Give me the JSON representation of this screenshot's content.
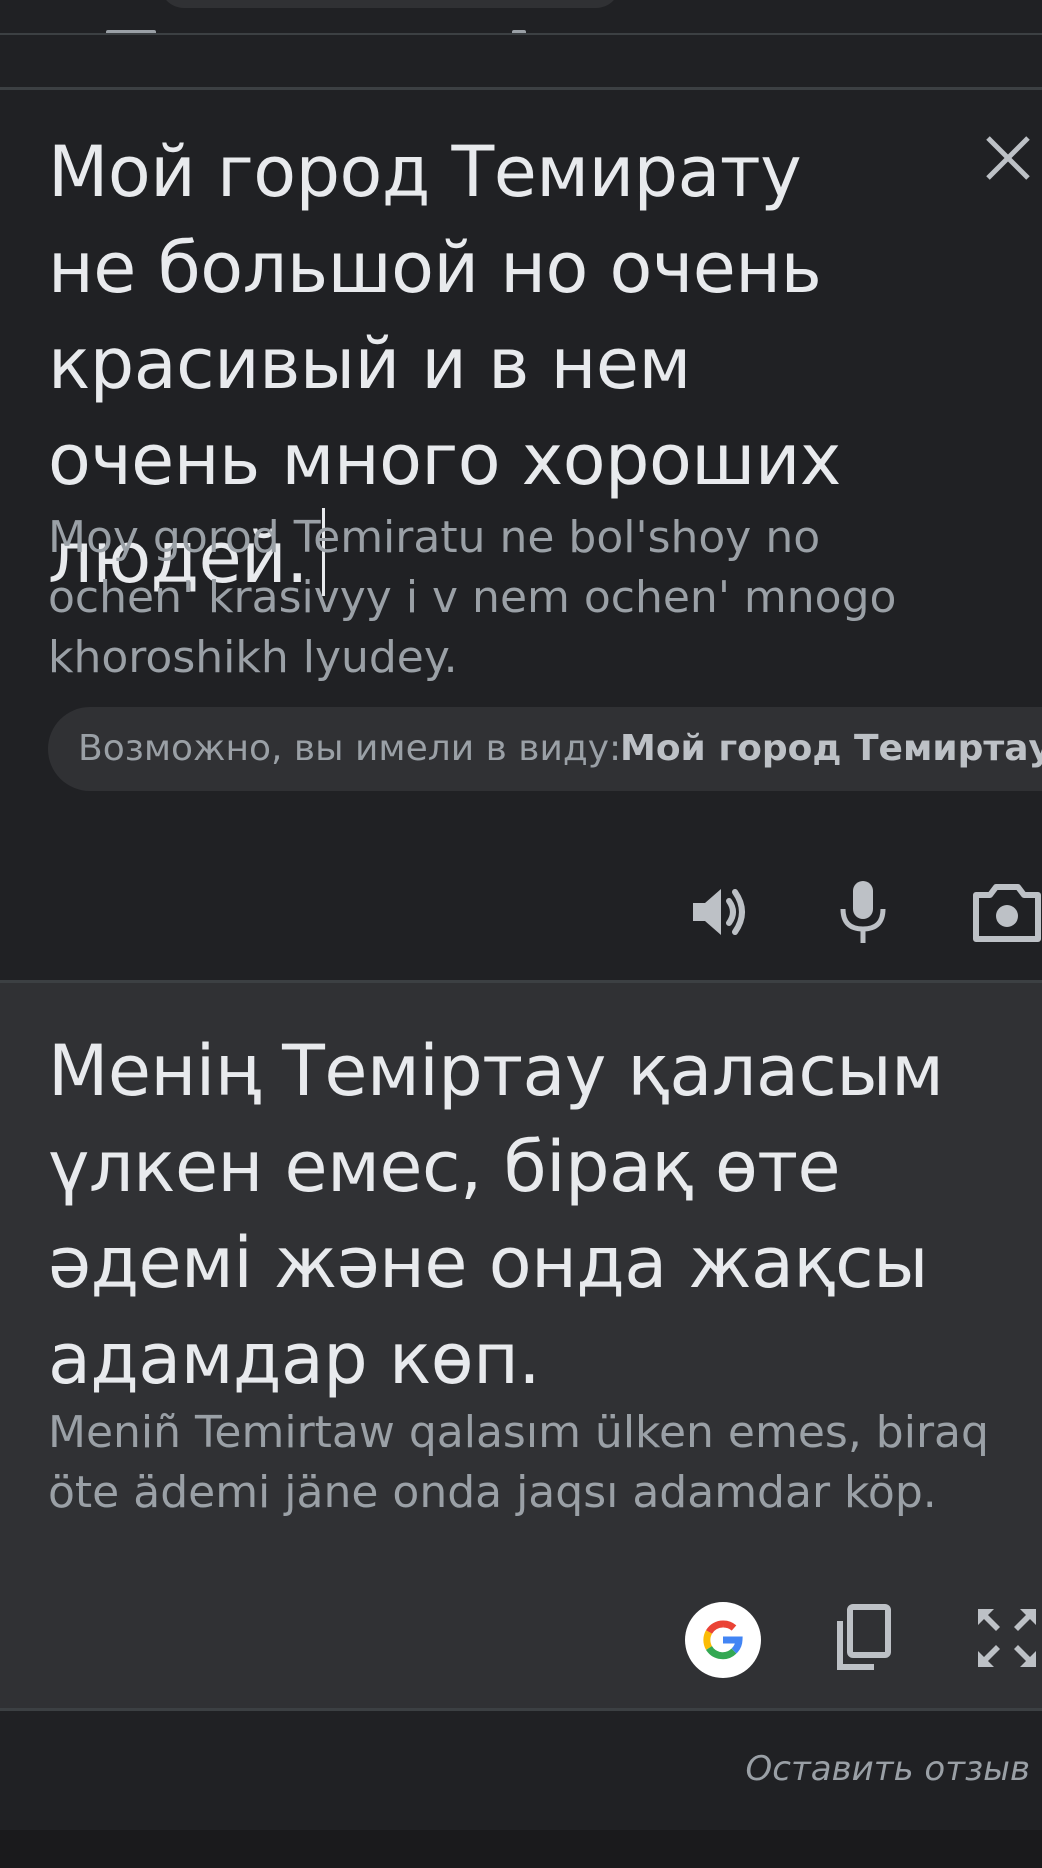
{
  "source": {
    "text": "Мой город Темирату не большой но очень красивый и в нем очень много хороших людей.",
    "transliteration": "Moy gorod Temiratu ne bol'shoy no ochen' krasivyy i v nem ochen' mnogo khoroshikh lyudey.",
    "suggestion_label": "Возможно, вы имели в виду:",
    "suggestion_value": "Мой город Темиртау не большой но очень красивый и в нем очень много хороших людей."
  },
  "target": {
    "text": "Менің Теміртау қаласым үлкен емес, бірақ өте әдемі және онда жақсы адамдар көп.",
    "transliteration": "Meniñ Temirtaw qalasım ülken emes, biraq öte ädemi jäne onda jaqsı adamdar köp."
  },
  "footer": {
    "feedback": "Оставить отзыв"
  },
  "icons": {
    "close": "close-icon",
    "speaker": "speaker-icon",
    "mic": "microphone-icon",
    "camera": "camera-icon",
    "google": "google-logo-icon",
    "copy": "copy-icon",
    "fullscreen": "fullscreen-icon"
  },
  "colors": {
    "background": "#202124",
    "panel": "#303134",
    "text_primary": "#e8eaed",
    "text_secondary": "#9aa0a6",
    "icon": "#bdc1c6"
  }
}
